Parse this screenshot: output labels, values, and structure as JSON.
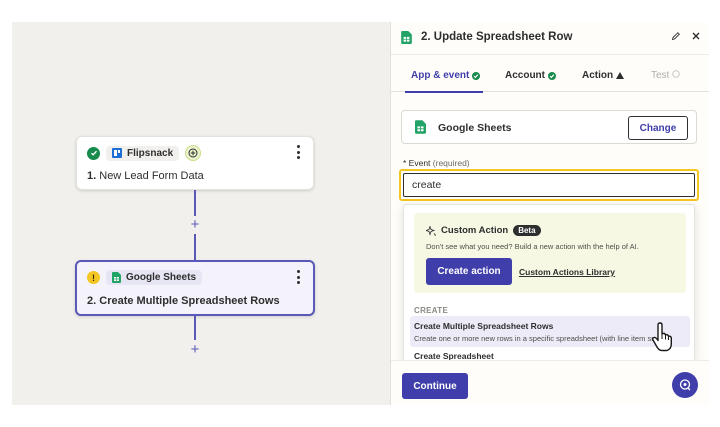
{
  "canvas": {
    "step1": {
      "app_name": "Flipsnack",
      "number": "1.",
      "title": "New Lead Form Data",
      "status_icon": "check-circle-icon"
    },
    "step2": {
      "app_name": "Google Sheets",
      "number": "2.",
      "title": "Create Multiple Spreadsheet Rows",
      "status_icon": "warning-circle-icon"
    },
    "add_step_label": "+"
  },
  "panel": {
    "title": "2. Update Spreadsheet Row",
    "tabs": [
      {
        "label": "App & event",
        "status": "complete",
        "active": true
      },
      {
        "label": "Account",
        "status": "complete",
        "active": false
      },
      {
        "label": "Action",
        "status": "warning",
        "active": false
      },
      {
        "label": "Test",
        "status": "disabled",
        "active": false
      }
    ],
    "app": {
      "name": "Google Sheets",
      "change_label": "Change"
    },
    "event": {
      "label": "* Event",
      "required_label": "(required)",
      "value": "create"
    },
    "dropdown": {
      "custom_action": {
        "title": "Custom Action",
        "badge": "Beta",
        "description": "Don't see what you need? Build a new action with the help of AI.",
        "create_button": "Create action",
        "library_link": "Custom Actions Library"
      },
      "section_header": "CREATE",
      "options": [
        {
          "title": "Create Multiple Spreadsheet Rows",
          "description": "Create one or more new rows in a specific spreadsheet (with line item su",
          "highlighted": true
        },
        {
          "title": "Create Spreadsheet",
          "description": "",
          "highlighted": false
        }
      ]
    },
    "continue_label": "Continue"
  },
  "colors": {
    "primary": "#3f3eaa",
    "success": "#178a4d",
    "warning": "#f3c623",
    "canvas_bg": "#f1f0ec"
  }
}
